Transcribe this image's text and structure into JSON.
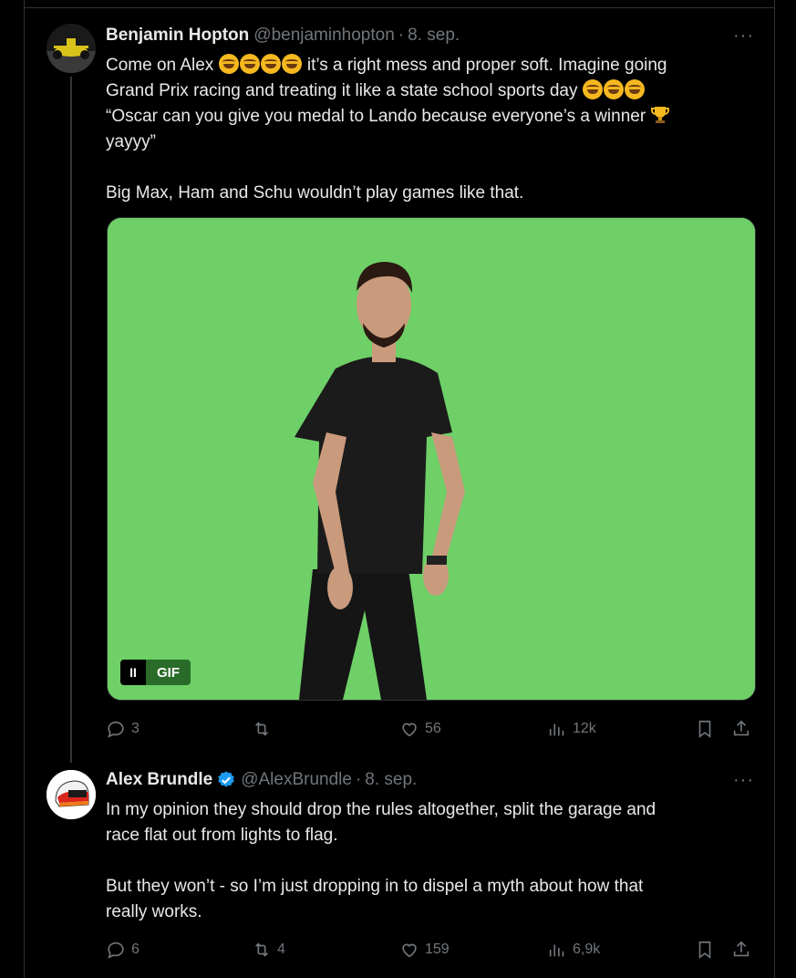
{
  "tweets": [
    {
      "name": "Benjamin Hopton",
      "handle": "@benjaminhopton",
      "date": "8. sep.",
      "more": "···",
      "text_line1_a": "Come on Alex ",
      "text_line1_b": " it’s a right mess and proper soft. Imagine going",
      "text_line2": "Grand Prix racing and treating it like a state school sports day ",
      "text_line3": "“Oscar can you give you medal to Lando because everyone’s a winner ",
      "text_line4": "yayyy”",
      "text_line5": "Big Max, Ham and Schu wouldn’t play games like that.",
      "gif_label": "GIF",
      "gif_pause": "II",
      "replies": "3",
      "reposts": "",
      "likes": "56",
      "views": "12k"
    },
    {
      "name": "Alex Brundle",
      "handle": "@AlexBrundle",
      "date": "8. sep.",
      "more": "···",
      "text_line1": "In my opinion they should drop the rules altogether, split the garage and",
      "text_line2": "race flat out from lights to flag.",
      "text_line3": "But they won’t - so I’m just dropping in to dispel a myth about how that",
      "text_line4": "really works.",
      "replies": "6",
      "reposts": "4",
      "likes": "159",
      "views": "6,9k"
    }
  ],
  "colors": {
    "background": "#000000",
    "text": "#e7e9ea",
    "muted": "#71767b",
    "verified": "#1d9bf0",
    "greenscreen": "#6ed067"
  },
  "icons": [
    "reply-icon",
    "repost-icon",
    "like-icon",
    "views-icon",
    "bookmark-icon",
    "share-icon",
    "verified-icon",
    "grinning-emoji-icon",
    "trophy-emoji-icon"
  ]
}
